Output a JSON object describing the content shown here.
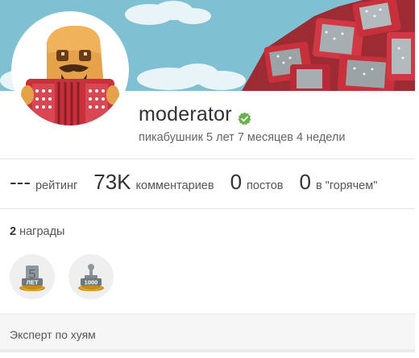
{
  "profile": {
    "username": "moderator",
    "tenure": "пикабушник 5 лет 7 месяцев 4 недели",
    "verified": true,
    "verified_icon": "verified-check-icon"
  },
  "stats": [
    {
      "value": "---",
      "label": "рейтинг"
    },
    {
      "value": "73K",
      "label": "комментариев"
    },
    {
      "value": "0",
      "label": "постов"
    },
    {
      "value": "0",
      "label": "в \"горячем\""
    }
  ],
  "awards": {
    "count": "2",
    "label": "награды",
    "items": [
      {
        "icon": "five-years-award-icon",
        "text": "ЛЕТ",
        "number": "5"
      },
      {
        "icon": "thousand-award-icon",
        "text": "1000"
      }
    ]
  },
  "bio": {
    "text": "Эксперт по хуям"
  },
  "colors": {
    "banner_sky": "#78bcd0",
    "accordion_red": "#c8303c",
    "verified_green": "#6ab04c"
  }
}
